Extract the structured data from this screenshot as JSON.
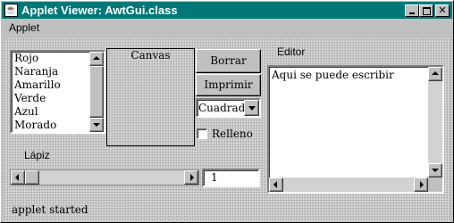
{
  "window": {
    "title": "Applet Viewer: AwtGui.class",
    "controls": [
      "minimize",
      "maximize",
      "close"
    ]
  },
  "menu": {
    "items": [
      "Applet"
    ]
  },
  "list": {
    "items": [
      "Rojo",
      "Naranja",
      "Amarillo",
      "Verde",
      "Azul",
      "Morado"
    ]
  },
  "canvas": {
    "label": "Canvas"
  },
  "buttons": {
    "borrar": "Borrar",
    "imprimir": "Imprimir"
  },
  "shape_select": {
    "value": "Cuadrado"
  },
  "fill_checkbox": {
    "label": "Relleno",
    "checked": false
  },
  "editor": {
    "label": "Editor",
    "text": "Aqui se puede escribir"
  },
  "pencil": {
    "label": "Lápiz",
    "value": "1"
  },
  "status": {
    "text": "applet started"
  },
  "icons": {
    "app": "java-icon",
    "minimize": "minimize-icon",
    "maximize": "maximize-icon",
    "close": "close-icon"
  }
}
